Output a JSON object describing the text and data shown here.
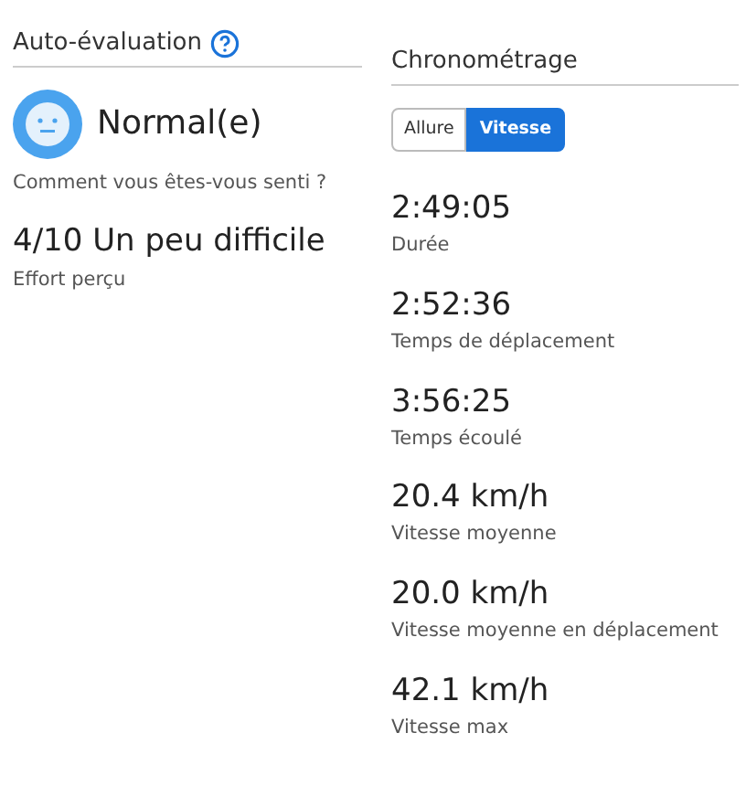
{
  "self_evaluation": {
    "title": "Auto-évaluation",
    "feeling": {
      "value": "Normal(e)",
      "label": "Comment vous êtes-vous senti ?"
    },
    "effort": {
      "value": "4/10 Un peu difficile",
      "label": "Effort perçu"
    }
  },
  "timing": {
    "title": "Chronométrage",
    "toggle": [
      {
        "label": "Allure",
        "selected": false
      },
      {
        "label": "Vitesse",
        "selected": true
      }
    ],
    "stats": [
      {
        "value": "2:49:05",
        "label": "Durée"
      },
      {
        "value": "2:52:36",
        "label": "Temps de déplacement"
      },
      {
        "value": "3:56:25",
        "label": "Temps écoulé"
      },
      {
        "value": "20.4 km/h",
        "label": "Vitesse moyenne"
      },
      {
        "value": "20.0 km/h",
        "label": "Vitesse moyenne en déplacement"
      },
      {
        "value": "42.1 km/h",
        "label": "Vitesse max"
      }
    ]
  }
}
